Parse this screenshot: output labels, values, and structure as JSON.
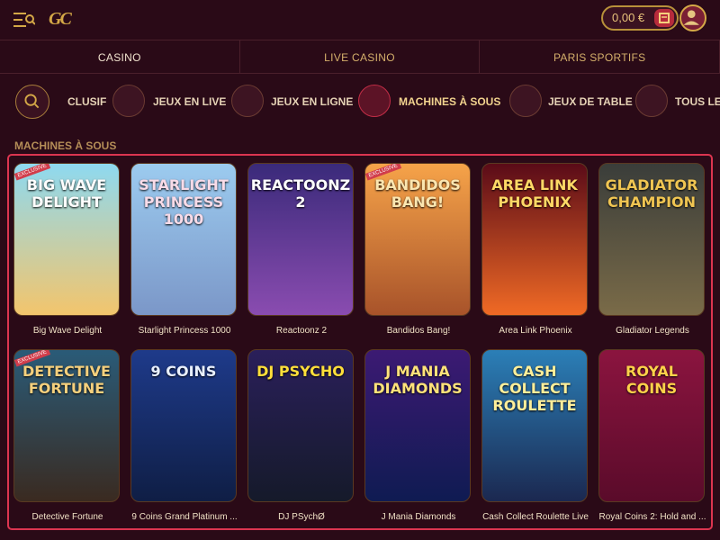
{
  "topbar": {
    "logo_text": "GC",
    "balance": "0,00 €",
    "menu_icon": "menu-icon",
    "wallet_icon": "wallet-icon",
    "avatar_icon": "user-icon"
  },
  "tabs": [
    {
      "label": "CASINO"
    },
    {
      "label": "LIVE CASINO"
    },
    {
      "label": "PARIS SPORTIFS"
    }
  ],
  "categories": [
    {
      "label": "CLUSIF",
      "icon": "search-icon"
    },
    {
      "label": "JEUX EN LIVE",
      "icon": "cards-icon"
    },
    {
      "label": "JEUX EN LIGNE",
      "icon": "table-icon"
    },
    {
      "label": "MACHINES À SOUS",
      "icon": "slot-icon"
    },
    {
      "label": "JEUX DE TABLE",
      "icon": "chip-icon"
    },
    {
      "label": "TOUS LES",
      "icon": "cherry-icon"
    }
  ],
  "section": {
    "title": "MACHINES À SOUS"
  },
  "games": [
    {
      "title": "Big Wave Delight",
      "thumb": "Big Wave Delight",
      "badge": "EXCLUSIVE"
    },
    {
      "title": "Starlight Princess 1000",
      "thumb": "Starlight Princess 1000",
      "badge": ""
    },
    {
      "title": "Reactoonz 2",
      "thumb": "Reactoonz 2",
      "badge": ""
    },
    {
      "title": "Bandidos Bang!",
      "thumb": "Bandidos Bang!",
      "badge": "EXCLUSIVE"
    },
    {
      "title": "Area Link Phoenix",
      "thumb": "Area Link Phoenix",
      "badge": ""
    },
    {
      "title": "Gladiator Legends",
      "thumb": "Gladiator Champion",
      "badge": ""
    },
    {
      "title": "Detective Fortune",
      "thumb": "Detective Fortune",
      "badge": "EXCLUSIVE"
    },
    {
      "title": "9 Coins Grand Platinum ...",
      "thumb": "9 Coins",
      "badge": ""
    },
    {
      "title": "DJ PSychØ",
      "thumb": "DJ Psycho",
      "badge": ""
    },
    {
      "title": "J Mania Diamonds",
      "thumb": "J Mania Diamonds",
      "badge": ""
    },
    {
      "title": "Cash Collect Roulette Live",
      "thumb": "Cash Collect Roulette",
      "badge": ""
    },
    {
      "title": "Royal Coins 2: Hold and ...",
      "thumb": "Royal Coins",
      "badge": ""
    }
  ],
  "colors": {
    "background": "#2a0a17",
    "gold": "#d4a847",
    "accent": "#db3550"
  }
}
